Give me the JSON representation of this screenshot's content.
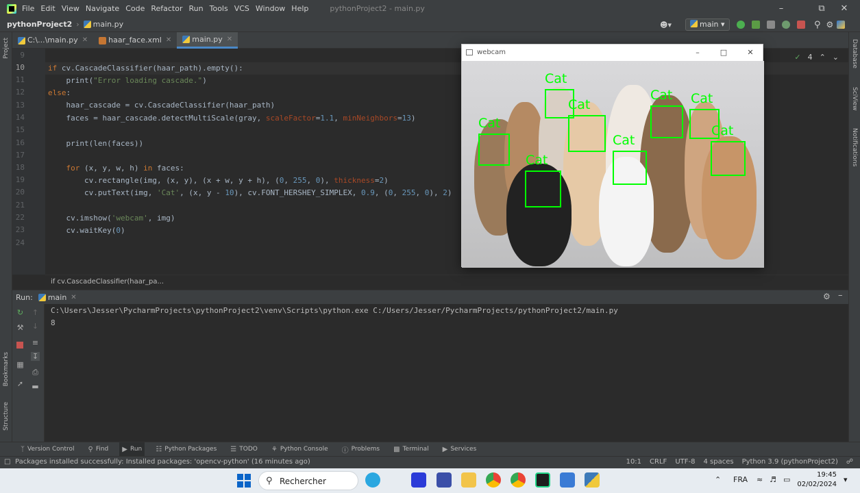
{
  "menu": {
    "items": [
      "File",
      "Edit",
      "View",
      "Navigate",
      "Code",
      "Refactor",
      "Run",
      "Tools",
      "VCS",
      "Window",
      "Help"
    ],
    "window_title": "pythonProject2 - main.py"
  },
  "nav": {
    "project": "pythonProject2",
    "file": "main.py",
    "run_config": "main"
  },
  "tabs": [
    {
      "label": "C:\\...\\main.py",
      "icon": "python-file-icon"
    },
    {
      "label": "haar_face.xml",
      "icon": "xml-file-icon"
    },
    {
      "label": "main.py",
      "icon": "python-file-icon",
      "active": true
    }
  ],
  "editor": {
    "line_numbers": [
      "9",
      "10",
      "11",
      "12",
      "13",
      "14",
      "15",
      "16",
      "17",
      "18",
      "19",
      "20",
      "21",
      "22",
      "23",
      "24"
    ],
    "inspection_count": "4",
    "breadcrumb": "if cv.CascadeClassifier(haar_pa..."
  },
  "run": {
    "label": "Run:",
    "tab": "main",
    "output": [
      "C:\\Users\\Jesser\\PycharmProjects\\pythonProject2\\venv\\Scripts\\python.exe C:/Users/Jesser/PycharmProjects/pythonProject2/main.py",
      "8"
    ]
  },
  "left_strip": [
    "Project",
    "Bookmarks",
    "Structure"
  ],
  "right_strip": [
    "Database",
    "SciView",
    "Notifications"
  ],
  "bottom_tools": [
    {
      "label": "Version Control",
      "icon": "branch-icon"
    },
    {
      "label": "Find",
      "icon": "search-icon"
    },
    {
      "label": "Run",
      "icon": "run-icon",
      "active": true
    },
    {
      "label": "Python Packages",
      "icon": "packages-icon"
    },
    {
      "label": "TODO",
      "icon": "list-icon"
    },
    {
      "label": "Python Console",
      "icon": "console-icon"
    },
    {
      "label": "Problems",
      "icon": "problems-icon"
    },
    {
      "label": "Terminal",
      "icon": "terminal-icon"
    },
    {
      "label": "Services",
      "icon": "services-icon"
    }
  ],
  "status": {
    "message": "Packages installed successfully: Installed packages: 'opencv-python' (16 minutes ago)",
    "position": "10:1",
    "line_sep": "CRLF",
    "encoding": "UTF-8",
    "indent": "4 spaces",
    "interpreter": "Python 3.9 (pythonProject2)"
  },
  "webcam": {
    "title": "webcam",
    "detections": [
      {
        "label": "Cat"
      },
      {
        "label": "Cat"
      },
      {
        "label": "Cat"
      },
      {
        "label": "Cat"
      },
      {
        "label": "Cat"
      },
      {
        "label": "Cat"
      },
      {
        "label": "Cat"
      },
      {
        "label": "Cat"
      }
    ]
  },
  "taskbar": {
    "search_placeholder": "Rechercher",
    "lang": "FRA",
    "time": "19:45",
    "date": "02/02/2024"
  },
  "colors": {
    "ide_bg": "#2b2b2b",
    "panel_bg": "#3c3f41",
    "keyword": "#cc7832",
    "string": "#6a8759",
    "number": "#6897bb",
    "detection": "#00ff00"
  }
}
